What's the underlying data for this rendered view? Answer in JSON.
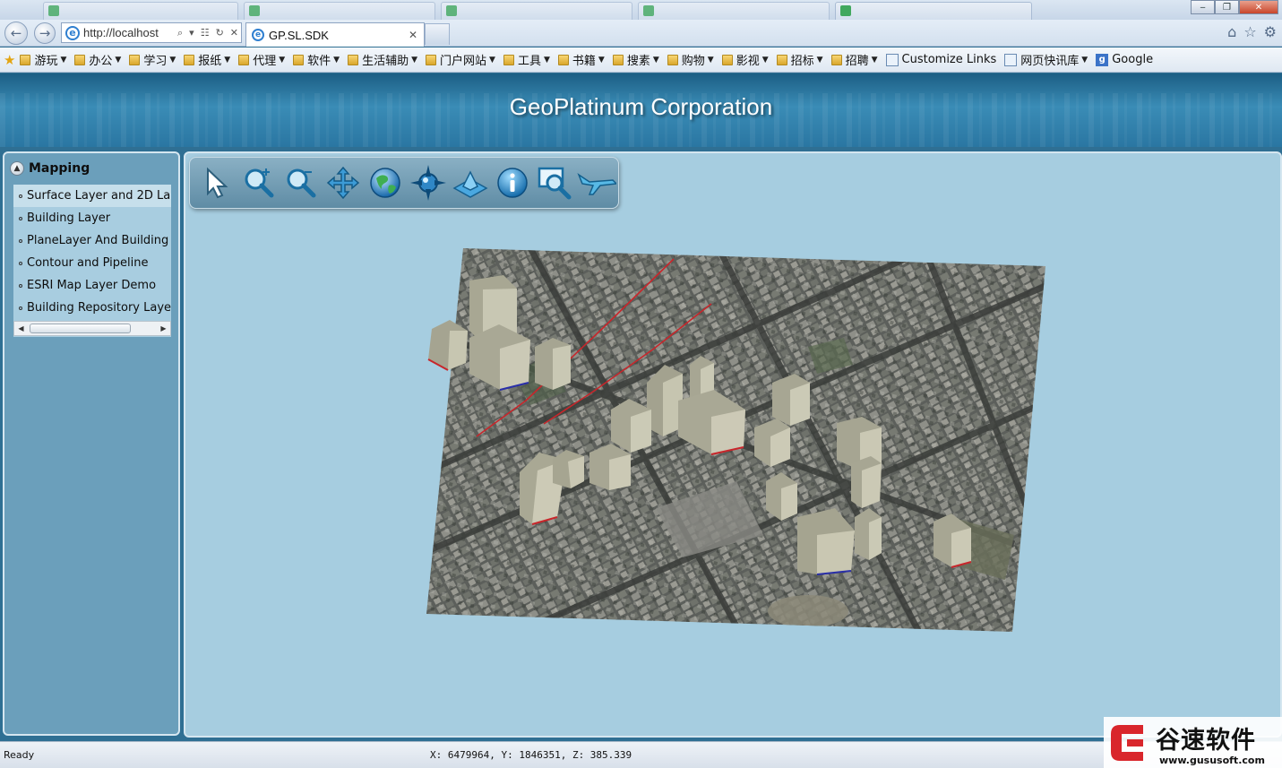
{
  "browser": {
    "address": "http://localhost",
    "active_tab_title": "GP.SL.SDK",
    "favorites": [
      {
        "label": "游玩",
        "type": "folder"
      },
      {
        "label": "办公",
        "type": "folder"
      },
      {
        "label": "学习",
        "type": "folder"
      },
      {
        "label": "报纸",
        "type": "folder"
      },
      {
        "label": "代理",
        "type": "folder"
      },
      {
        "label": "软件",
        "type": "folder"
      },
      {
        "label": "生活辅助",
        "type": "folder"
      },
      {
        "label": "门户网站",
        "type": "folder"
      },
      {
        "label": "工具",
        "type": "folder"
      },
      {
        "label": "书籍",
        "type": "folder"
      },
      {
        "label": "搜素",
        "type": "folder"
      },
      {
        "label": "购物",
        "type": "folder"
      },
      {
        "label": "影视",
        "type": "folder"
      },
      {
        "label": "招标",
        "type": "folder"
      },
      {
        "label": "招聘",
        "type": "folder"
      },
      {
        "label": "Customize Links",
        "type": "link"
      },
      {
        "label": "网页快讯库",
        "type": "feed"
      },
      {
        "label": "Google",
        "type": "google"
      }
    ]
  },
  "banner": {
    "title": "GeoPlatinum Corporation"
  },
  "sidebar": {
    "title": "Mapping",
    "items": [
      {
        "label": "Surface Layer and 2D La",
        "selected": true
      },
      {
        "label": "Building Layer",
        "selected": false
      },
      {
        "label": "PlaneLayer And Building",
        "selected": false
      },
      {
        "label": "Contour and Pipeline",
        "selected": false
      },
      {
        "label": "ESRI Map Layer Demo",
        "selected": false
      },
      {
        "label": "Building Repository Laye",
        "selected": false
      }
    ]
  },
  "toolbar": {
    "tools": [
      {
        "name": "select-arrow-icon"
      },
      {
        "name": "zoom-in-icon"
      },
      {
        "name": "zoom-out-icon"
      },
      {
        "name": "pan-icon"
      },
      {
        "name": "globe-icon"
      },
      {
        "name": "navigate-icon"
      },
      {
        "name": "plane-layer-icon"
      },
      {
        "name": "info-icon"
      },
      {
        "name": "zoom-extent-icon"
      },
      {
        "name": "fly-icon"
      }
    ]
  },
  "status": {
    "text": "Ready",
    "coords": "X: 6479964, Y: 1846351, Z: 385.339"
  },
  "watermark": {
    "text": "谷速软件",
    "url": "www.gususoft.com"
  }
}
